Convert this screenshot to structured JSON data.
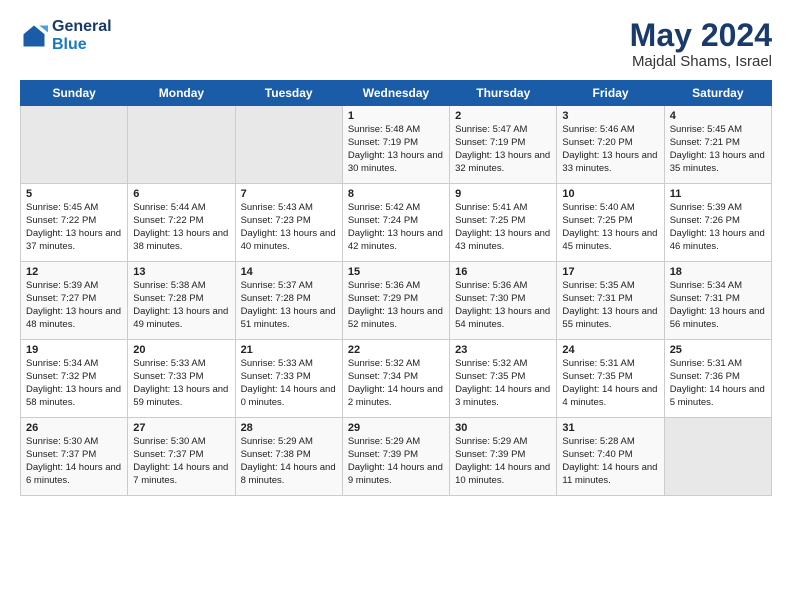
{
  "header": {
    "logo_line1": "General",
    "logo_line2": "Blue",
    "month_title": "May 2024",
    "location": "Majdal Shams, Israel"
  },
  "days_of_week": [
    "Sunday",
    "Monday",
    "Tuesday",
    "Wednesday",
    "Thursday",
    "Friday",
    "Saturday"
  ],
  "weeks": [
    [
      {
        "day": "",
        "empty": true
      },
      {
        "day": "",
        "empty": true
      },
      {
        "day": "",
        "empty": true
      },
      {
        "day": "1",
        "sunrise": "5:48 AM",
        "sunset": "7:19 PM",
        "daylight": "13 hours and 30 minutes."
      },
      {
        "day": "2",
        "sunrise": "5:47 AM",
        "sunset": "7:19 PM",
        "daylight": "13 hours and 32 minutes."
      },
      {
        "day": "3",
        "sunrise": "5:46 AM",
        "sunset": "7:20 PM",
        "daylight": "13 hours and 33 minutes."
      },
      {
        "day": "4",
        "sunrise": "5:45 AM",
        "sunset": "7:21 PM",
        "daylight": "13 hours and 35 minutes."
      }
    ],
    [
      {
        "day": "5",
        "sunrise": "5:45 AM",
        "sunset": "7:22 PM",
        "daylight": "13 hours and 37 minutes."
      },
      {
        "day": "6",
        "sunrise": "5:44 AM",
        "sunset": "7:22 PM",
        "daylight": "13 hours and 38 minutes."
      },
      {
        "day": "7",
        "sunrise": "5:43 AM",
        "sunset": "7:23 PM",
        "daylight": "13 hours and 40 minutes."
      },
      {
        "day": "8",
        "sunrise": "5:42 AM",
        "sunset": "7:24 PM",
        "daylight": "13 hours and 42 minutes."
      },
      {
        "day": "9",
        "sunrise": "5:41 AM",
        "sunset": "7:25 PM",
        "daylight": "13 hours and 43 minutes."
      },
      {
        "day": "10",
        "sunrise": "5:40 AM",
        "sunset": "7:25 PM",
        "daylight": "13 hours and 45 minutes."
      },
      {
        "day": "11",
        "sunrise": "5:39 AM",
        "sunset": "7:26 PM",
        "daylight": "13 hours and 46 minutes."
      }
    ],
    [
      {
        "day": "12",
        "sunrise": "5:39 AM",
        "sunset": "7:27 PM",
        "daylight": "13 hours and 48 minutes."
      },
      {
        "day": "13",
        "sunrise": "5:38 AM",
        "sunset": "7:28 PM",
        "daylight": "13 hours and 49 minutes."
      },
      {
        "day": "14",
        "sunrise": "5:37 AM",
        "sunset": "7:28 PM",
        "daylight": "13 hours and 51 minutes."
      },
      {
        "day": "15",
        "sunrise": "5:36 AM",
        "sunset": "7:29 PM",
        "daylight": "13 hours and 52 minutes."
      },
      {
        "day": "16",
        "sunrise": "5:36 AM",
        "sunset": "7:30 PM",
        "daylight": "13 hours and 54 minutes."
      },
      {
        "day": "17",
        "sunrise": "5:35 AM",
        "sunset": "7:31 PM",
        "daylight": "13 hours and 55 minutes."
      },
      {
        "day": "18",
        "sunrise": "5:34 AM",
        "sunset": "7:31 PM",
        "daylight": "13 hours and 56 minutes."
      }
    ],
    [
      {
        "day": "19",
        "sunrise": "5:34 AM",
        "sunset": "7:32 PM",
        "daylight": "13 hours and 58 minutes."
      },
      {
        "day": "20",
        "sunrise": "5:33 AM",
        "sunset": "7:33 PM",
        "daylight": "13 hours and 59 minutes."
      },
      {
        "day": "21",
        "sunrise": "5:33 AM",
        "sunset": "7:33 PM",
        "daylight": "14 hours and 0 minutes."
      },
      {
        "day": "22",
        "sunrise": "5:32 AM",
        "sunset": "7:34 PM",
        "daylight": "14 hours and 2 minutes."
      },
      {
        "day": "23",
        "sunrise": "5:32 AM",
        "sunset": "7:35 PM",
        "daylight": "14 hours and 3 minutes."
      },
      {
        "day": "24",
        "sunrise": "5:31 AM",
        "sunset": "7:35 PM",
        "daylight": "14 hours and 4 minutes."
      },
      {
        "day": "25",
        "sunrise": "5:31 AM",
        "sunset": "7:36 PM",
        "daylight": "14 hours and 5 minutes."
      }
    ],
    [
      {
        "day": "26",
        "sunrise": "5:30 AM",
        "sunset": "7:37 PM",
        "daylight": "14 hours and 6 minutes."
      },
      {
        "day": "27",
        "sunrise": "5:30 AM",
        "sunset": "7:37 PM",
        "daylight": "14 hours and 7 minutes."
      },
      {
        "day": "28",
        "sunrise": "5:29 AM",
        "sunset": "7:38 PM",
        "daylight": "14 hours and 8 minutes."
      },
      {
        "day": "29",
        "sunrise": "5:29 AM",
        "sunset": "7:39 PM",
        "daylight": "14 hours and 9 minutes."
      },
      {
        "day": "30",
        "sunrise": "5:29 AM",
        "sunset": "7:39 PM",
        "daylight": "14 hours and 10 minutes."
      },
      {
        "day": "31",
        "sunrise": "5:28 AM",
        "sunset": "7:40 PM",
        "daylight": "14 hours and 11 minutes."
      },
      {
        "day": "",
        "empty": true
      }
    ]
  ]
}
